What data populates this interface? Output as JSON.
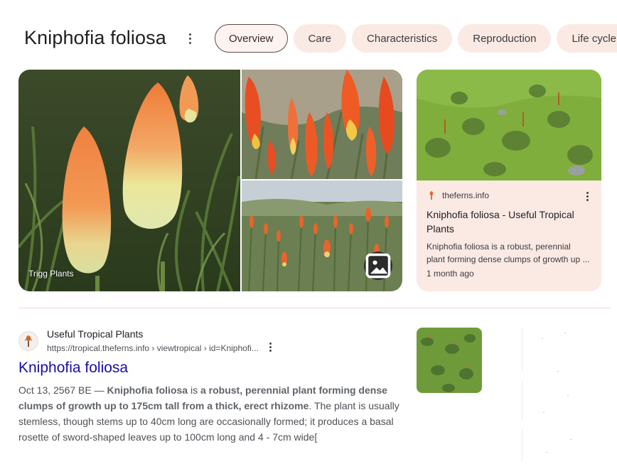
{
  "header": {
    "title": "Kniphofia foliosa",
    "chips": [
      {
        "label": "Overview",
        "active": true
      },
      {
        "label": "Care",
        "active": false
      },
      {
        "label": "Characteristics",
        "active": false
      },
      {
        "label": "Reproduction",
        "active": false
      },
      {
        "label": "Life cycle",
        "active": false
      }
    ]
  },
  "gallery": {
    "caption": "Trigg Plants"
  },
  "card": {
    "source": "theferns.info",
    "title": "Kniphofia foliosa - Useful Tropical Plants",
    "snippet_line1": "Kniphofia foliosa is a robust, perennial",
    "snippet_line2": "plant forming dense clumps of growth up ...",
    "time": "1 month ago"
  },
  "result": {
    "site_name": "Useful Tropical Plants",
    "url": "https://tropical.theferns.info › viewtropical › id=Kniphofi...",
    "title": "Kniphofia foliosa",
    "date": "Oct 13, 2567 BE",
    "dash": " — ",
    "s1": "Kniphofia foliosa",
    "s2": " is ",
    "s3": "a robust, perennial plant forming dense clumps of growth up to 175cm tall from a thick, erect rhizome",
    "s4": ". The plant is usually stemless, though stems up to 40cm long are occasionally formed; it produces a basal rosette of sword-shaped leaves up to 100cm long and 4 - 7cm wide["
  },
  "colors": {
    "chip_bg": "#fbe9e4",
    "card_bg": "#fbe9e4",
    "link": "#1a0dab",
    "flower_orange": "#f07a3a",
    "flower_yellow": "#e8e08a"
  }
}
